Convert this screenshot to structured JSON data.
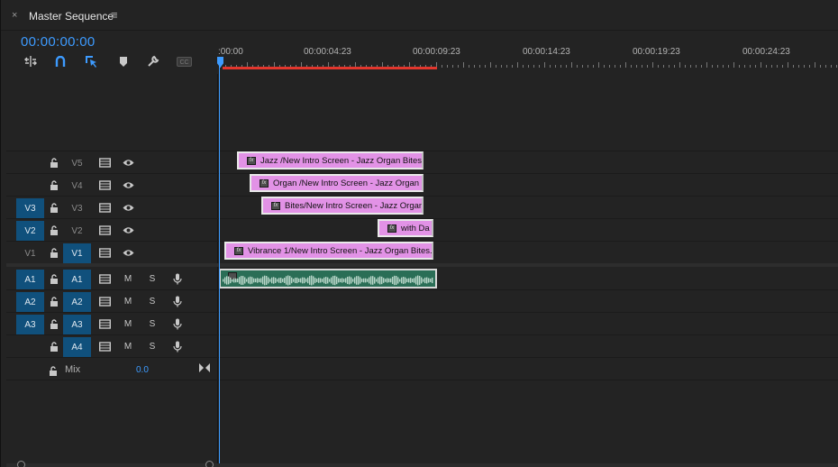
{
  "tab": {
    "close": "×",
    "title": "Master Sequence",
    "menu": "≡"
  },
  "timecode": "00:00:00:00",
  "toolbar": [
    {
      "name": "insert-edit-icon",
      "glyph": "⇥"
    },
    {
      "name": "snap-icon",
      "glyph": "∩"
    },
    {
      "name": "linked-selection-icon",
      "glyph": "⇱"
    },
    {
      "name": "add-marker-icon",
      "glyph": "◆"
    },
    {
      "name": "settings-wrench-icon",
      "glyph": "✎"
    },
    {
      "name": "captions-icon",
      "glyph": "CC"
    }
  ],
  "ruler": {
    "labels": [
      ":00:00",
      "00:00:04:23",
      "00:00:09:23",
      "00:00:14:23",
      "00:00:19:23",
      "00:00:24:23"
    ]
  },
  "video_tracks": [
    {
      "src": "",
      "name": "V5",
      "src_on": false,
      "tgt_on": false
    },
    {
      "src": "",
      "name": "V4",
      "src_on": false,
      "tgt_on": false
    },
    {
      "src": "V3",
      "name": "V3",
      "src_on": true,
      "tgt_on": false
    },
    {
      "src": "V2",
      "name": "V2",
      "src_on": true,
      "tgt_on": false
    },
    {
      "src": "V1",
      "name": "V1",
      "src_on": false,
      "tgt_on": true
    }
  ],
  "audio_tracks": [
    {
      "src": "A1",
      "name": "A1",
      "src_on": true,
      "tgt_on": true,
      "mute": "M",
      "solo": "S"
    },
    {
      "src": "A2",
      "name": "A2",
      "src_on": true,
      "tgt_on": true,
      "mute": "M",
      "solo": "S"
    },
    {
      "src": "A3",
      "name": "A3",
      "src_on": true,
      "tgt_on": true,
      "mute": "M",
      "solo": "S"
    },
    {
      "src": "",
      "name": "A4",
      "src_on": false,
      "tgt_on": true,
      "mute": "M",
      "solo": "S"
    }
  ],
  "mix": {
    "label": "Mix",
    "value": "0.0"
  },
  "clips": [
    {
      "track": "V5",
      "label": "Jazz  /New Intro Screen - Jazz Organ Bites."
    },
    {
      "track": "V4",
      "label": "Organ /New Intro Screen - Jazz Organ"
    },
    {
      "track": "V3",
      "label": "Bites/New Intro Screen - Jazz Organ"
    },
    {
      "track": "V2",
      "label": "with Da"
    },
    {
      "track": "V1",
      "label": "Vibrance 1/New Intro Screen - Jazz Organ Bites.p"
    }
  ],
  "colors": {
    "accent": "#3d9bff",
    "work_area": "#e2362d",
    "video_clip": "#e292e6",
    "audio_clip": "#2a6e56",
    "track_target": "#10507c"
  }
}
